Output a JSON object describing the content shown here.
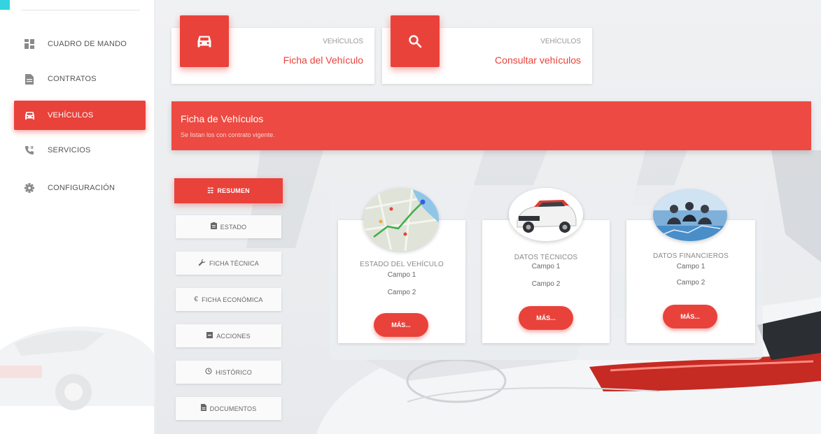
{
  "sidebar": {
    "items": [
      {
        "label": "CUADRO DE MANDO",
        "icon": "dashboard-icon"
      },
      {
        "label": "CONTRATOS",
        "icon": "document-icon"
      },
      {
        "label": "VEHÍCULOS",
        "icon": "car-icon"
      },
      {
        "label": "SERVICIOS",
        "icon": "phone-icon"
      },
      {
        "label": "CONFIGURACIÓN",
        "icon": "gear-icon"
      }
    ],
    "active_index": 2
  },
  "top_cards": [
    {
      "category": "VEHÍCULOS",
      "title": "Ficha del Vehículo",
      "icon": "car-icon"
    },
    {
      "category": "VEHÍCULOS",
      "title": "Consultar vehículos",
      "icon": "search-icon"
    }
  ],
  "banner": {
    "title": "Ficha de Vehículos",
    "subtitle": "Se listan los con contrato vigente."
  },
  "tabs": [
    {
      "label": "RESUMEN",
      "icon": "grid-icon"
    },
    {
      "label": "ESTADO",
      "icon": "clipboard-icon"
    },
    {
      "label": "FICHA TÉCNICA",
      "icon": "wrench-icon"
    },
    {
      "label": "FICHA ECONÓMICA",
      "icon": "euro-icon"
    },
    {
      "label": "ACCIONES",
      "icon": "box-icon"
    },
    {
      "label": "HISTÓRICO",
      "icon": "history-icon"
    },
    {
      "label": "DOCUMENTOS",
      "icon": "file-icon"
    }
  ],
  "info_cards": [
    {
      "title": "ESTADO DEL VEHÍCULO",
      "field1": "Campo 1",
      "field2": "Campo 2",
      "button": "MÁS...",
      "image": "map-image"
    },
    {
      "title": "DATOS TÉCNICOS",
      "field1": "Campo 1",
      "field2": "Campo 2",
      "button": "MÁS...",
      "image": "car-image"
    },
    {
      "title": "DATOS FINANCIEROS",
      "field1": "Campo 1",
      "field2": "Campo 2",
      "button": "MÁS...",
      "image": "meeting-image"
    }
  ],
  "colors": {
    "accent": "#e9423b",
    "corner": "#34d3e0",
    "sidebar_bg": "#ffffff",
    "main_bg": "#eceef0"
  }
}
